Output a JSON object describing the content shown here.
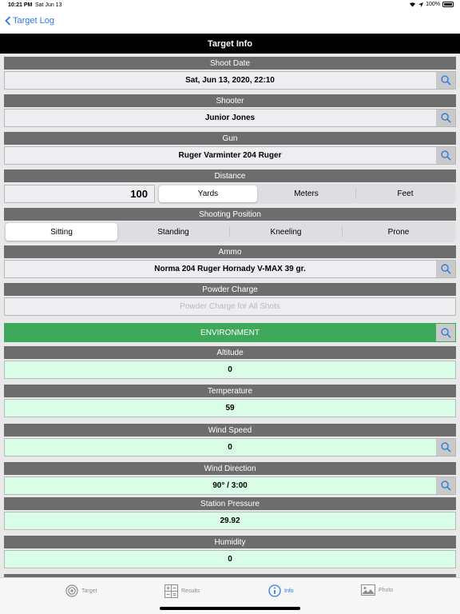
{
  "status": {
    "time": "10:21 PM",
    "date": "Sat Jun 13",
    "battery": "100%"
  },
  "nav": {
    "back_label": "Target Log"
  },
  "title": "Target Info",
  "sections": {
    "shoot_date": {
      "header": "Shoot Date",
      "value": "Sat, Jun 13, 2020, 22:10"
    },
    "shooter": {
      "header": "Shooter",
      "value": "Junior Jones"
    },
    "gun": {
      "header": "Gun",
      "value": "Ruger Varminter 204 Ruger"
    },
    "distance": {
      "header": "Distance",
      "value": "100",
      "units": [
        "Yards",
        "Meters",
        "Feet"
      ],
      "selected": "Yards"
    },
    "position": {
      "header": "Shooting Position",
      "options": [
        "Sitting",
        "Standing",
        "Kneeling",
        "Prone"
      ],
      "selected": "Sitting"
    },
    "ammo": {
      "header": "Ammo",
      "value": "Norma 204 Ruger Hornady V-MAX 39 gr."
    },
    "powder": {
      "header": "Powder Charge",
      "placeholder": "Powder Charge for All Shots"
    }
  },
  "environment": {
    "label": "ENVIRONMENT",
    "color": "#3ea95a",
    "altitude": {
      "header": "Altitude",
      "value": "0"
    },
    "temperature": {
      "header": "Temperature",
      "value": "59"
    },
    "wind_speed": {
      "header": "Wind Speed",
      "value": "0"
    },
    "wind_direction": {
      "header": "Wind Direction",
      "value": "90° / 3:00"
    },
    "station_pressure": {
      "header": "Station Pressure",
      "value": "29.92"
    },
    "humidity": {
      "header": "Humidity",
      "value": "0"
    }
  },
  "tabs": [
    {
      "label": "Target",
      "icon": "target-icon"
    },
    {
      "label": "Results",
      "icon": "calculator-icon"
    },
    {
      "label": "Info",
      "icon": "info-icon",
      "active": true
    },
    {
      "label": "Photo",
      "icon": "photo-icon"
    }
  ],
  "accent_color": "#2a7ae2"
}
